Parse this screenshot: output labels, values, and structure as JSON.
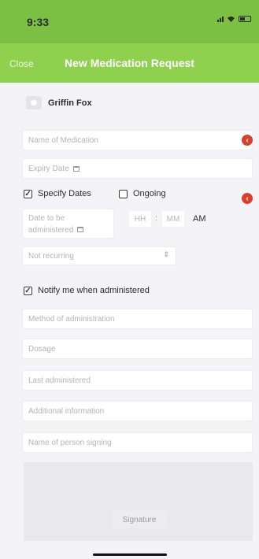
{
  "status_bar": {
    "time": "9:33"
  },
  "nav": {
    "close_label": "Close",
    "title": "New Medication Request"
  },
  "patient": {
    "name": "Griffin Fox"
  },
  "form": {
    "medication_name_placeholder": "Name of Medication",
    "expiry_date_placeholder": "Expiry Date",
    "specify_dates": {
      "label": "Specify Dates",
      "checked": true
    },
    "ongoing": {
      "label": "Ongoing",
      "checked": false
    },
    "date_to_be_placeholder": "Date to be",
    "administered_placeholder": "administered",
    "hour_placeholder": "HH",
    "minute_placeholder": "MM",
    "ampm": "AM",
    "recurrence_value": "Not recurring",
    "notify": {
      "label": "Notify me when administered",
      "checked": true
    },
    "method_placeholder": "Method of administration",
    "dosage_placeholder": "Dosage",
    "last_administered_placeholder": "Last administered",
    "additional_info_placeholder": "Additional information",
    "signer_name_placeholder": "Name of person signing",
    "signature_label": "Signature"
  },
  "icons": {
    "required": "arrow-left-circle-icon",
    "calendar": "calendar-icon"
  },
  "colors": {
    "header_green": "#8fd14f",
    "status_green": "#7cc043",
    "required_red": "#d9412f"
  }
}
